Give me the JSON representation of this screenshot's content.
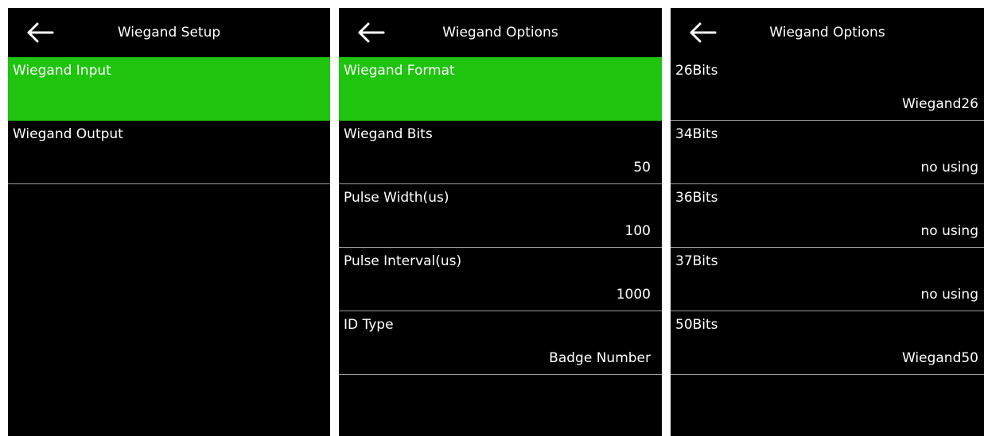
{
  "colors": {
    "screen_bg": "#000000",
    "selected_bg": "#1ec40e",
    "divider": "#9e9e9e",
    "text": "#ffffff"
  },
  "screens": [
    {
      "title": "Wiegand Setup",
      "back_icon": "arrow-left-icon",
      "items": [
        {
          "label": "Wiegand Input",
          "value": "",
          "selected": true
        },
        {
          "label": "Wiegand Output",
          "value": "",
          "selected": false
        }
      ]
    },
    {
      "title": "Wiegand Options",
      "back_icon": "arrow-left-icon",
      "items": [
        {
          "label": "Wiegand Format",
          "value": "",
          "selected": true
        },
        {
          "label": "Wiegand Bits",
          "value": "50",
          "selected": false
        },
        {
          "label": "Pulse Width(us)",
          "value": "100",
          "selected": false
        },
        {
          "label": "Pulse Interval(us)",
          "value": "1000",
          "selected": false
        },
        {
          "label": "ID Type",
          "value": "Badge Number",
          "selected": false
        }
      ]
    },
    {
      "title": "Wiegand Options",
      "back_icon": "arrow-left-icon",
      "items": [
        {
          "label": "26Bits",
          "value": "Wiegand26",
          "selected": false
        },
        {
          "label": "34Bits",
          "value": "no using",
          "selected": false
        },
        {
          "label": "36Bits",
          "value": "no using",
          "selected": false
        },
        {
          "label": "37Bits",
          "value": "no using",
          "selected": false
        },
        {
          "label": "50Bits",
          "value": "Wiegand50",
          "selected": false
        }
      ]
    }
  ]
}
